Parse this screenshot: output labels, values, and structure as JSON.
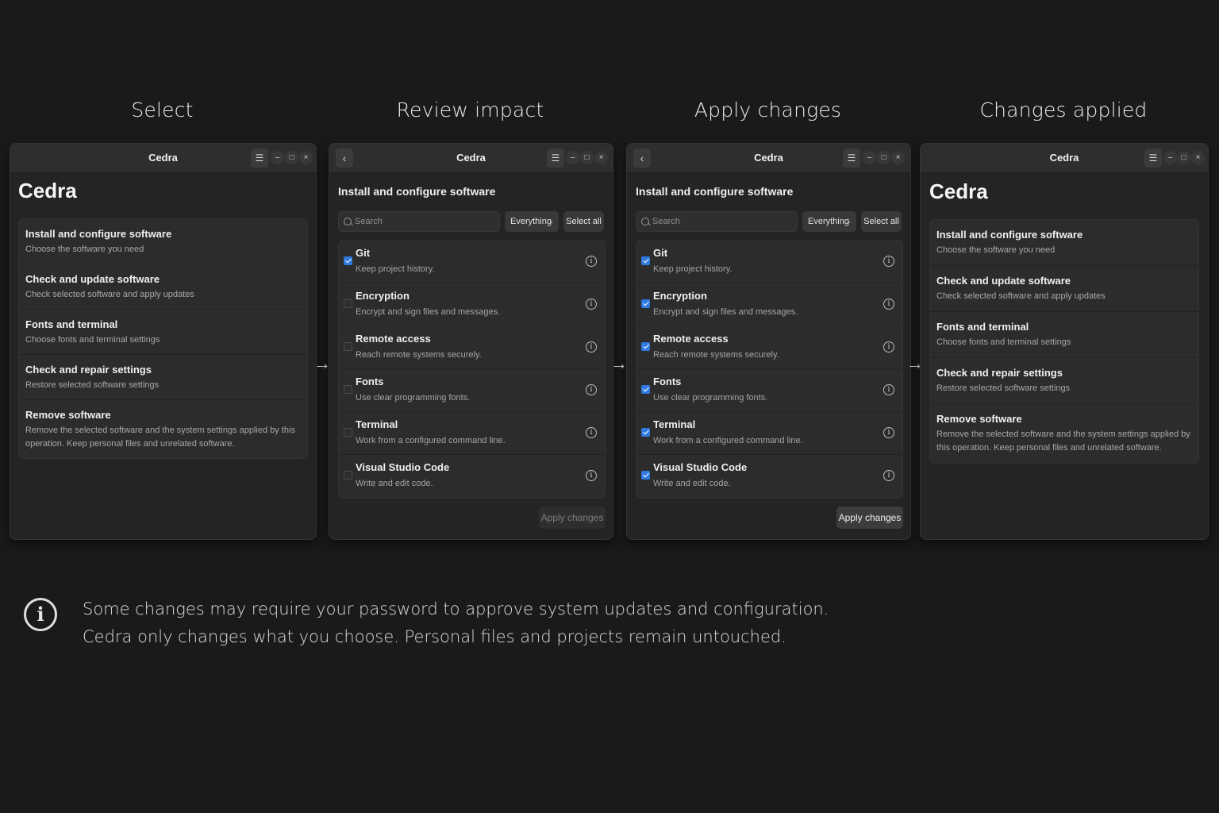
{
  "steps": [
    "Select",
    "Review impact",
    "Apply changes",
    "Changes applied"
  ],
  "window": {
    "title": "Cedra",
    "menu_icon": "☰",
    "minimize_icon": "–",
    "maximize_icon": "□",
    "close_icon": "×",
    "back_icon": "‹"
  },
  "home": {
    "title": "Cedra",
    "items": [
      {
        "title": "Install and configure software",
        "subtitle": "Choose the software you need"
      },
      {
        "title": "Check and update software",
        "subtitle": "Check selected software and apply updates"
      },
      {
        "title": "Fonts and terminal",
        "subtitle": "Choose fonts and terminal settings"
      },
      {
        "title": "Check and repair settings",
        "subtitle": "Restore selected software settings"
      },
      {
        "title": "Remove software",
        "subtitle": "Remove the selected software and the system settings applied by this operation. Keep personal files and unrelated software."
      }
    ]
  },
  "install": {
    "heading": "Install and configure software",
    "search_placeholder": "Search",
    "filter_value": "Everything",
    "select_all": "Select all",
    "apply_label": "Apply changes",
    "options": [
      {
        "title": "Git",
        "subtitle": "Keep project history."
      },
      {
        "title": "Encryption",
        "subtitle": "Encrypt and sign files and messages."
      },
      {
        "title": "Remote access",
        "subtitle": "Reach remote systems securely."
      },
      {
        "title": "Fonts",
        "subtitle": "Use clear programming fonts."
      },
      {
        "title": "Terminal",
        "subtitle": "Work from a configured command line."
      },
      {
        "title": "Visual Studio Code",
        "subtitle": "Write and edit code."
      }
    ],
    "review_checked": [
      true,
      false,
      false,
      false,
      false,
      false
    ],
    "apply_checked": [
      true,
      true,
      true,
      true,
      true,
      true
    ]
  },
  "arrow_glyph": "→",
  "notice": {
    "icon": "info-icon",
    "glyph": "i",
    "line1": "Some changes may require your password to approve system updates and configuration.",
    "line2": "Cedra only changes what you choose. Personal files and projects remain untouched."
  },
  "colors": {
    "background": "#1a1a1b",
    "window": "#242424",
    "accent": "#2f7ae0"
  }
}
